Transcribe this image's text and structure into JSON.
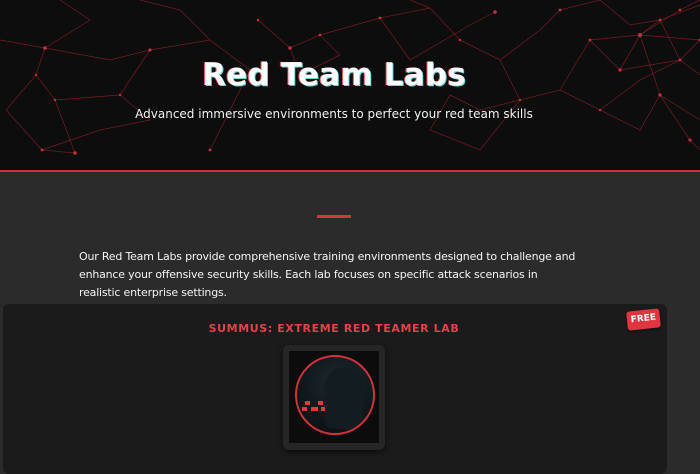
{
  "hero": {
    "title": "Red Team Labs",
    "subtitle": "Advanced immersive environments to perfect your red team skills"
  },
  "intro": {
    "text": "Our Red Team Labs provide comprehensive training environments designed to challenge and enhance your offensive security skills. Each lab focuses on specific attack scenarios in realistic enterprise settings."
  },
  "labs": [
    {
      "title": "SUMMUS: EXTREME RED TEAMER LAB",
      "badge": "FREE",
      "image": "hooded-figure-logo-icon"
    }
  ],
  "colors": {
    "accent": "#d6363f",
    "hero_bg": "#0d0d0e",
    "page_bg": "#2b2b2c",
    "card_bg": "#1b1b1c"
  }
}
